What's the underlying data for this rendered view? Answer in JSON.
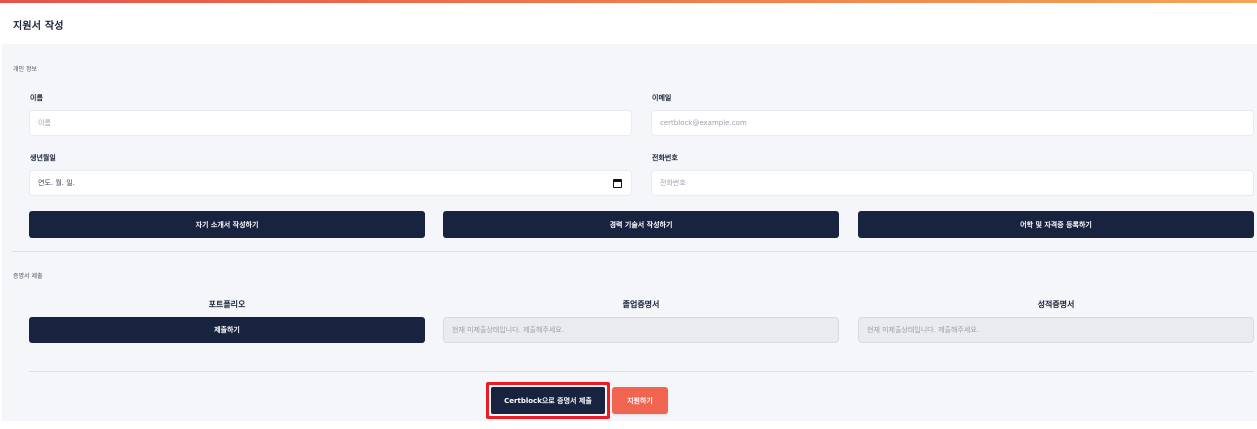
{
  "page": {
    "title": "지원서 작성"
  },
  "colors": {
    "primary": "#17233f",
    "accent": "#f0654f",
    "highlight": "#ec1c24"
  },
  "personal": {
    "section_label": "개인 정보",
    "name_label": "이름",
    "name_placeholder": "이름",
    "email_label": "이메일",
    "email_placeholder": "certblock@example.com",
    "birth_label": "생년월일",
    "birth_placeholder": "연도. 월. 일.",
    "phone_label": "전화번호",
    "phone_placeholder": "전화번호"
  },
  "actions": {
    "intro": "자기 소개서 작성하기",
    "career": "경력 기술서 작성하기",
    "language": "어학 및 자격증 등록하기"
  },
  "certificates": {
    "section_label": "증명서 제출",
    "portfolio_title": "포트폴리오",
    "portfolio_button": "제출하기",
    "graduation_title": "졸업증명서",
    "graduation_status": "현재 미제출상태입니다. 제출해주세요.",
    "transcript_title": "성적증명서",
    "transcript_status": "현재 미제출상태입니다. 제출해주세요."
  },
  "footer": {
    "certblock_button": "Certblock으로 증명서 제출",
    "apply_button": "지원하기"
  }
}
